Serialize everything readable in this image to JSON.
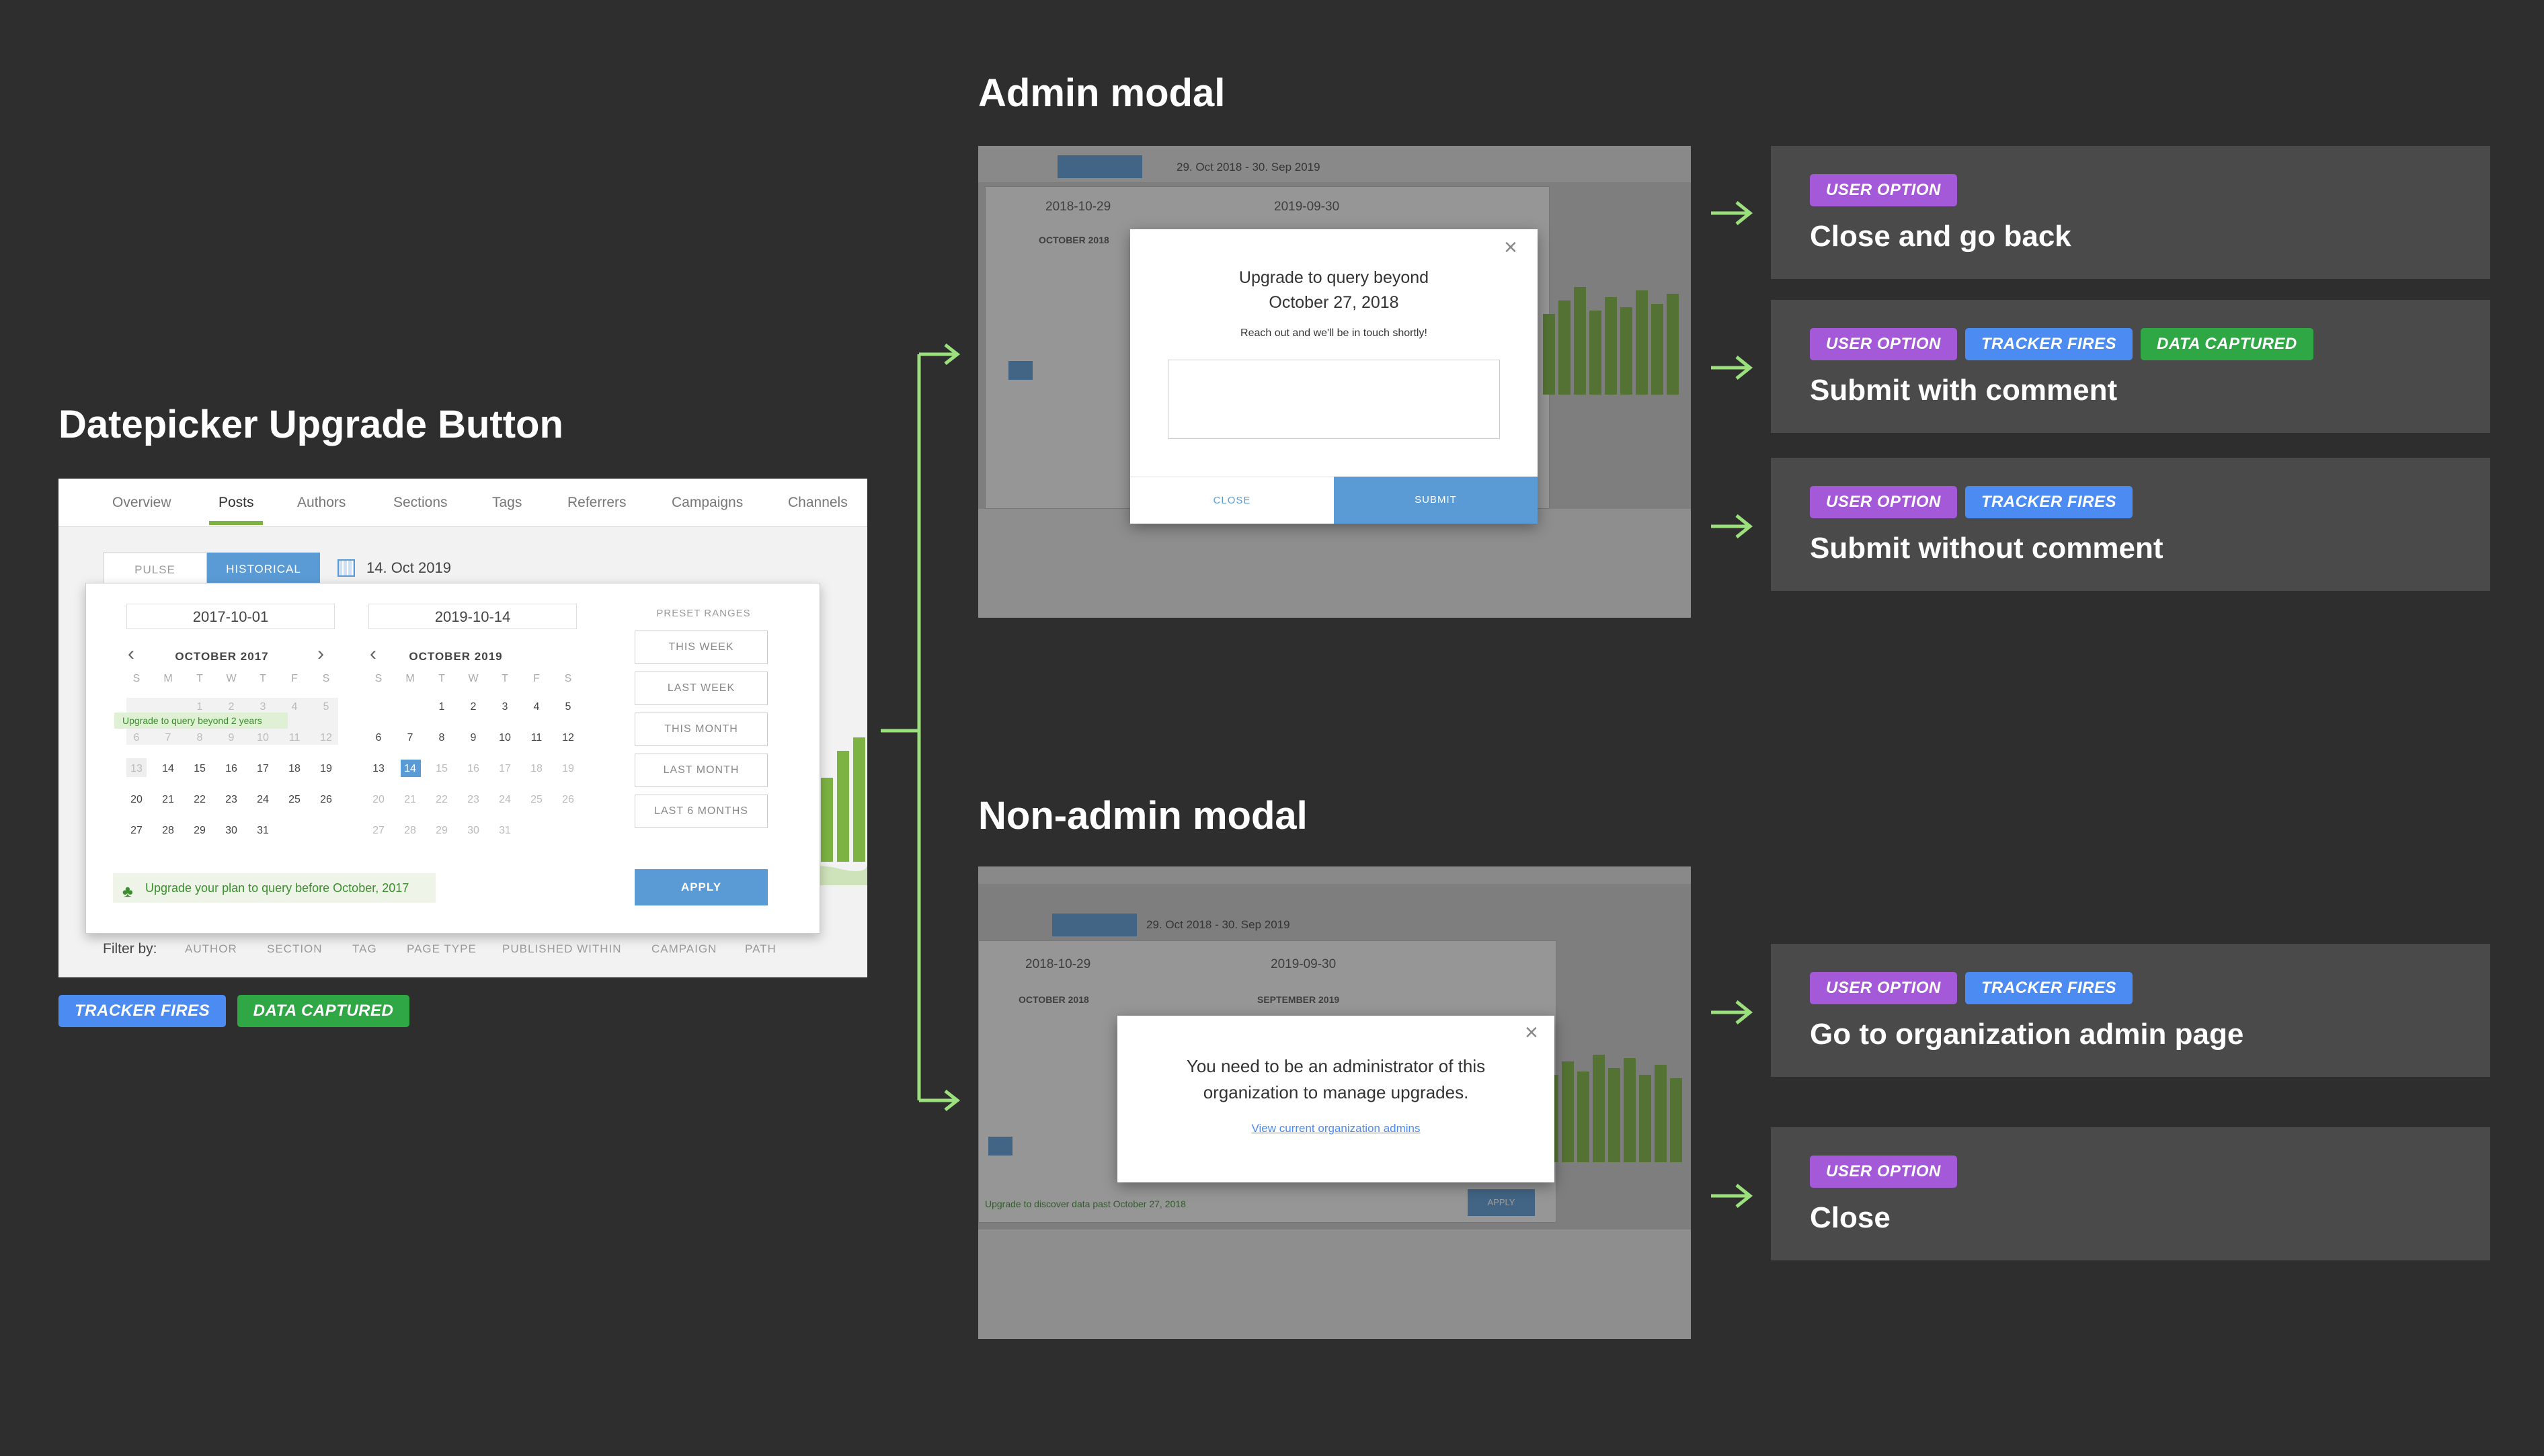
{
  "sections": {
    "datepicker_title": "Datepicker Upgrade Button",
    "admin_title": "Admin modal",
    "nonadmin_title": "Non-admin modal"
  },
  "nav_tabs": [
    "Overview",
    "Posts",
    "Authors",
    "Sections",
    "Tags",
    "Referrers",
    "Campaigns",
    "Channels"
  ],
  "toggle": {
    "pulse": "PULSE",
    "historical": "HISTORICAL"
  },
  "date_display": "14. Oct 2019",
  "datepicker": {
    "start_date": "2017-10-01",
    "end_date": "2019-10-14",
    "left_month": "OCTOBER 2017",
    "right_month": "OCTOBER 2019",
    "weekdays": [
      "S",
      "M",
      "T",
      "W",
      "T",
      "F",
      "S"
    ],
    "tooltip": "Upgrade to query beyond 2 years",
    "preset_heading": "PRESET RANGES",
    "presets": [
      "THIS WEEK",
      "LAST WEEK",
      "THIS MONTH",
      "LAST MONTH",
      "LAST 6 MONTHS"
    ],
    "upgrade_note": "Upgrade your plan to query before October, 2017",
    "apply": "APPLY"
  },
  "filter": {
    "label": "Filter by:",
    "options": [
      "AUTHOR",
      "SECTION",
      "TAG",
      "PAGE TYPE",
      "PUBLISHED WITHIN",
      "CAMPAIGN",
      "PATH"
    ]
  },
  "datepicker_badges": [
    "TRACKER FIRES",
    "DATA CAPTURED"
  ],
  "admin_modal": {
    "title_line1": "Upgrade to query beyond",
    "title_line2": "October 27, 2018",
    "subtitle": "Reach out and we'll be in touch shortly!",
    "comment_value": "",
    "close": "CLOSE",
    "submit": "SUBMIT",
    "bg_date": "29. Oct 2018 - 30. Sep 2019",
    "bg_start": "2018-10-29",
    "bg_end": "2019-09-30",
    "bg_month": "OCTOBER 2018"
  },
  "nonadmin_modal": {
    "text_line1": "You need to be an administrator of this",
    "text_line2": "organization to manage upgrades.",
    "link": "View current organization admins",
    "bg_date": "29. Oct 2018 - 30. Sep 2019",
    "bg_start": "2018-10-29",
    "bg_end": "2019-09-30",
    "bg_month_left": "OCTOBER 2018",
    "bg_month_right": "SEPTEMBER 2019",
    "bg_apply": "APPLY",
    "bg_note": "Upgrade to discover data past October 27, 2018"
  },
  "outcomes": [
    {
      "badges": [
        "USER OPTION"
      ],
      "title": "Close and go back"
    },
    {
      "badges": [
        "USER OPTION",
        "TRACKER FIRES",
        "DATA CAPTURED"
      ],
      "title": "Submit with comment"
    },
    {
      "badges": [
        "USER OPTION",
        "TRACKER FIRES"
      ],
      "title": "Submit without comment"
    },
    {
      "badges": [
        "USER OPTION",
        "TRACKER FIRES"
      ],
      "title": "Go to organization admin page"
    },
    {
      "badges": [
        "USER OPTION"
      ],
      "title": "Close"
    }
  ],
  "colors": {
    "background": "#2e2e2e",
    "card": "#4a4a4a",
    "user_option": "#a459d8",
    "tracker_fires": "#4b8bf2",
    "data_captured": "#2fa745",
    "connector": "#9be07c",
    "primary_button": "#5b9bd5",
    "chart_bar": "#7cb342"
  }
}
